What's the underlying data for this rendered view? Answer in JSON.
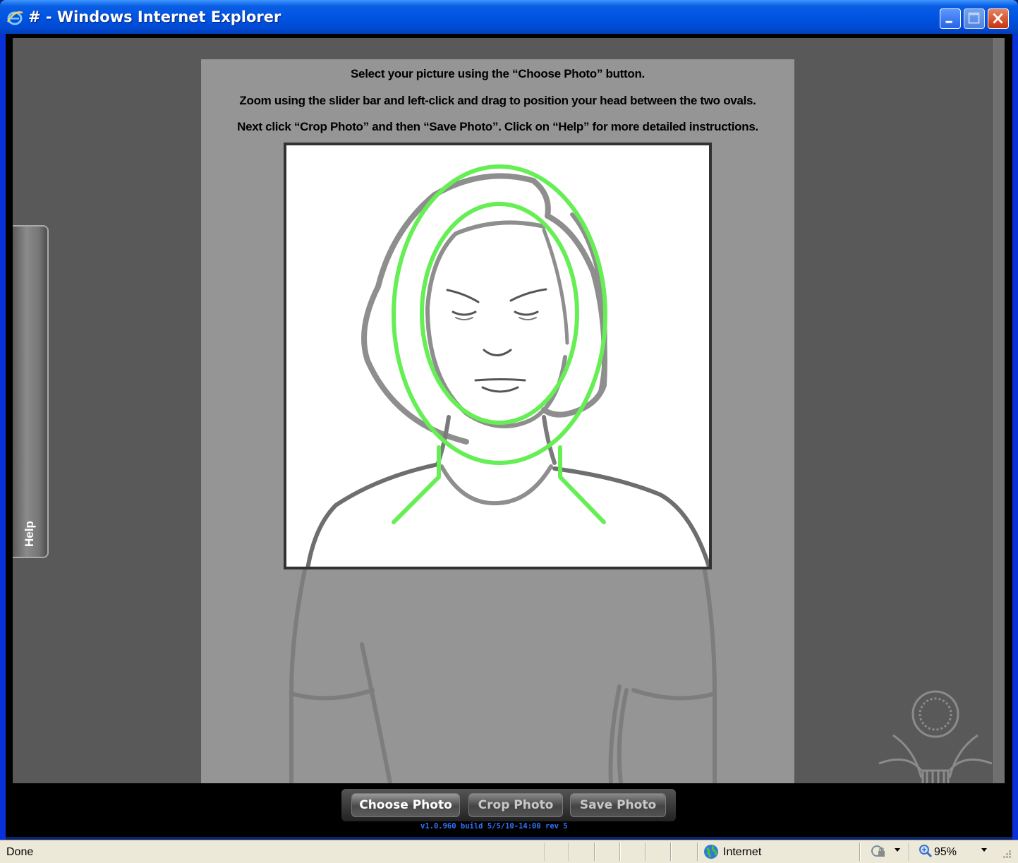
{
  "window": {
    "title": "# - Windows Internet Explorer"
  },
  "instructions": {
    "line1": "Select your picture using the “Choose Photo” button.",
    "line2": "Zoom using the slider bar and left-click and drag to position your head between the two ovals.",
    "line3": "Next click “Crop Photo” and then “Save Photo”.  Click on “Help” for more detailed instructions."
  },
  "help_tab": {
    "label": "Help"
  },
  "toolbar": {
    "choose_label": "Choose Photo",
    "crop_label": "Crop Photo",
    "save_label": "Save Photo",
    "version": "v1.0.960 build 5/5/10-14:00 rev 5"
  },
  "statusbar": {
    "status": "Done",
    "zone": "Internet",
    "zoom": "95%"
  },
  "icons": {
    "titlebar": "ie-logo-icon",
    "zone": "globe-icon",
    "security": "protected-mode-icon",
    "zoom": "magnifier-icon",
    "seal": "great-seal-icon"
  },
  "colors": {
    "guide_ovals": "#66ee55",
    "figure_outline": "#8c8c8c",
    "title_bar": "#0054e3",
    "version_text": "#2f74ff"
  }
}
